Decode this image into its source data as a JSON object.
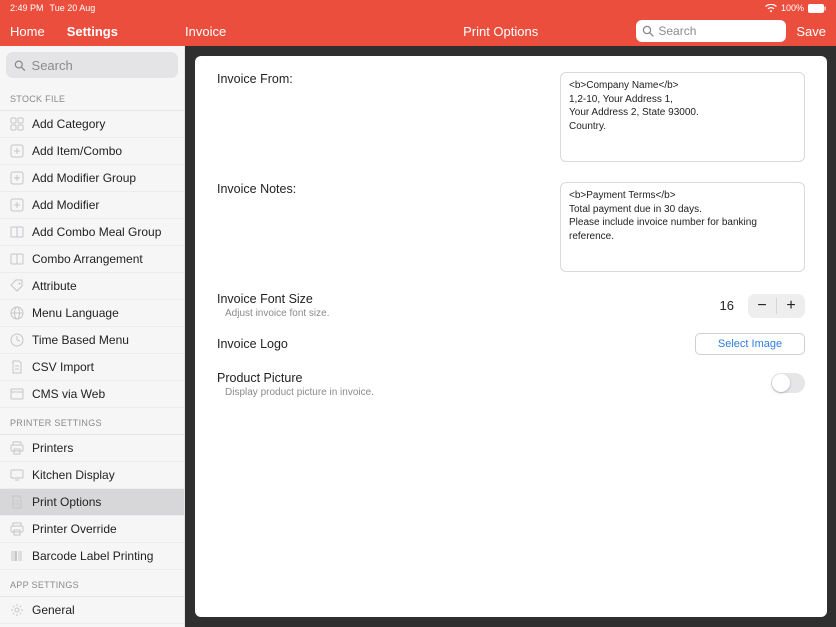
{
  "status": {
    "time": "2:49 PM",
    "date": "Tue 20 Aug",
    "battery": "100%"
  },
  "nav": {
    "home": "Home",
    "settings": "Settings",
    "breadcrumb": "Invoice",
    "title": "Print Options",
    "search_placeholder": "Search",
    "save": "Save"
  },
  "sidebar": {
    "search_placeholder": "Search",
    "sections": [
      {
        "header": "STOCK FILE",
        "items": [
          {
            "label": "Add Category",
            "icon": "category"
          },
          {
            "label": "Add Item/Combo",
            "icon": "plus-box"
          },
          {
            "label": "Add Modifier Group",
            "icon": "plus-box"
          },
          {
            "label": "Add Modifier",
            "icon": "plus-box"
          },
          {
            "label": "Add Combo Meal Group",
            "icon": "combo"
          },
          {
            "label": "Combo Arrangement",
            "icon": "combo"
          },
          {
            "label": "Attribute",
            "icon": "tag"
          },
          {
            "label": "Menu Language",
            "icon": "globe"
          },
          {
            "label": "Time Based Menu",
            "icon": "clock"
          },
          {
            "label": "CSV Import",
            "icon": "doc"
          },
          {
            "label": "CMS via Web",
            "icon": "web"
          }
        ]
      },
      {
        "header": "PRINTER SETTINGS",
        "items": [
          {
            "label": "Printers",
            "icon": "printer"
          },
          {
            "label": "Kitchen Display",
            "icon": "display"
          },
          {
            "label": "Print Options",
            "icon": "doc",
            "selected": true
          },
          {
            "label": "Printer Override",
            "icon": "printer"
          },
          {
            "label": "Barcode Label Printing",
            "icon": "barcode"
          }
        ]
      },
      {
        "header": "APP SETTINGS",
        "items": [
          {
            "label": "General",
            "icon": "gear"
          }
        ]
      }
    ]
  },
  "form": {
    "invoice_from_label": "Invoice From:",
    "invoice_from_value": "<b>Company Name</b>\n1,2-10, Your Address 1,\nYour Address 2, State 93000.\nCountry.",
    "invoice_notes_label": "Invoice Notes:",
    "invoice_notes_value": "<b>Payment Terms</b>\nTotal payment due in 30 days.\nPlease include invoice number for banking reference.",
    "font_size_label": "Invoice Font Size",
    "font_size_sub": "Adjust invoice font size.",
    "font_size_value": "16",
    "logo_label": "Invoice Logo",
    "select_image": "Select Image",
    "product_label": "Product Picture",
    "product_sub": "Display product picture in invoice.",
    "product_toggle": false
  }
}
